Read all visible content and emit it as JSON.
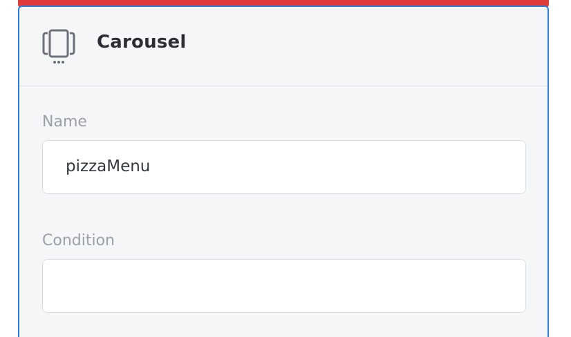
{
  "header": {
    "title": "Carousel",
    "icon": "carousel-icon"
  },
  "form": {
    "name": {
      "label": "Name",
      "value": "pizzaMenu"
    },
    "condition": {
      "label": "Condition",
      "value": ""
    }
  },
  "colors": {
    "alert_bar": "#e03c3c",
    "panel_border": "#2f7fd8",
    "panel_bg": "#f5f6f8"
  }
}
